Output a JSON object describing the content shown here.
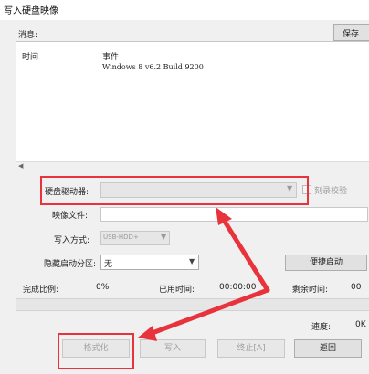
{
  "window": {
    "title": "写入硬盘映像"
  },
  "messages": {
    "label": "消息:",
    "save_label": "保存",
    "columns": {
      "time": "时间",
      "event": "事件"
    },
    "rows": [
      {
        "time": "",
        "event": "Windows 8 v6.2 Build 9200"
      }
    ]
  },
  "form": {
    "drive_label": "硬盘驱动器:",
    "drive_value": "",
    "verify_label": "刻录校验",
    "verify_checked": false,
    "image_file_label": "映像文件:",
    "image_file_value": "",
    "write_method_label": "写入方式:",
    "write_method_value": "USB-HDD+",
    "hidden_partition_label": "隐藏启动分区:",
    "hidden_partition_value": "无",
    "easy_boot_label": "便捷启动"
  },
  "status": {
    "completed_label": "完成比例:",
    "completed_value": "0%",
    "elapsed_label": "已用时间:",
    "elapsed_value": "00:00:00",
    "remaining_label": "剩余时间:",
    "remaining_value": "00",
    "progress_percent": 0,
    "speed_label": "速度:",
    "speed_value": "0K"
  },
  "buttons": {
    "format_label": "格式化",
    "write_label": "写入",
    "stop_label": "终止[A]",
    "back_label": "返回"
  },
  "colors": {
    "highlight": "#e8323c",
    "window_bg": "#f0f0f0"
  }
}
